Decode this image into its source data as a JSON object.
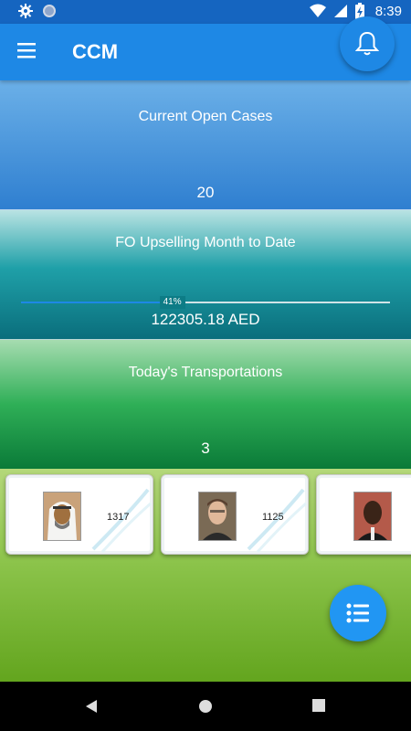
{
  "status_bar": {
    "time": "8:39",
    "icons": [
      "settings-icon",
      "circle-icon",
      "wifi-icon",
      "signal-icon",
      "battery-charging-icon"
    ]
  },
  "app_bar": {
    "title": "CCM",
    "menu_icon": "hamburger-icon",
    "notification_icon": "bell-icon"
  },
  "tiles": {
    "open_cases": {
      "label": "Current Open Cases",
      "value": "20"
    },
    "upselling": {
      "label": "FO Upselling Month to Date",
      "progress_percent": 41,
      "progress_label": "41%",
      "value": "122305.18 AED"
    },
    "transportations": {
      "label": "Today's Transportations",
      "value": "3"
    }
  },
  "staff_cards": [
    {
      "number": "1317"
    },
    {
      "number": "1125"
    },
    {
      "number": ""
    }
  ],
  "fab": {
    "icon": "list-icon"
  },
  "nav_bar": {
    "icons": [
      "back-icon",
      "home-icon",
      "recents-icon"
    ]
  },
  "colors": {
    "primary": "#1E88E5",
    "status_bar": "#1565C0",
    "fab": "#2196F3"
  }
}
